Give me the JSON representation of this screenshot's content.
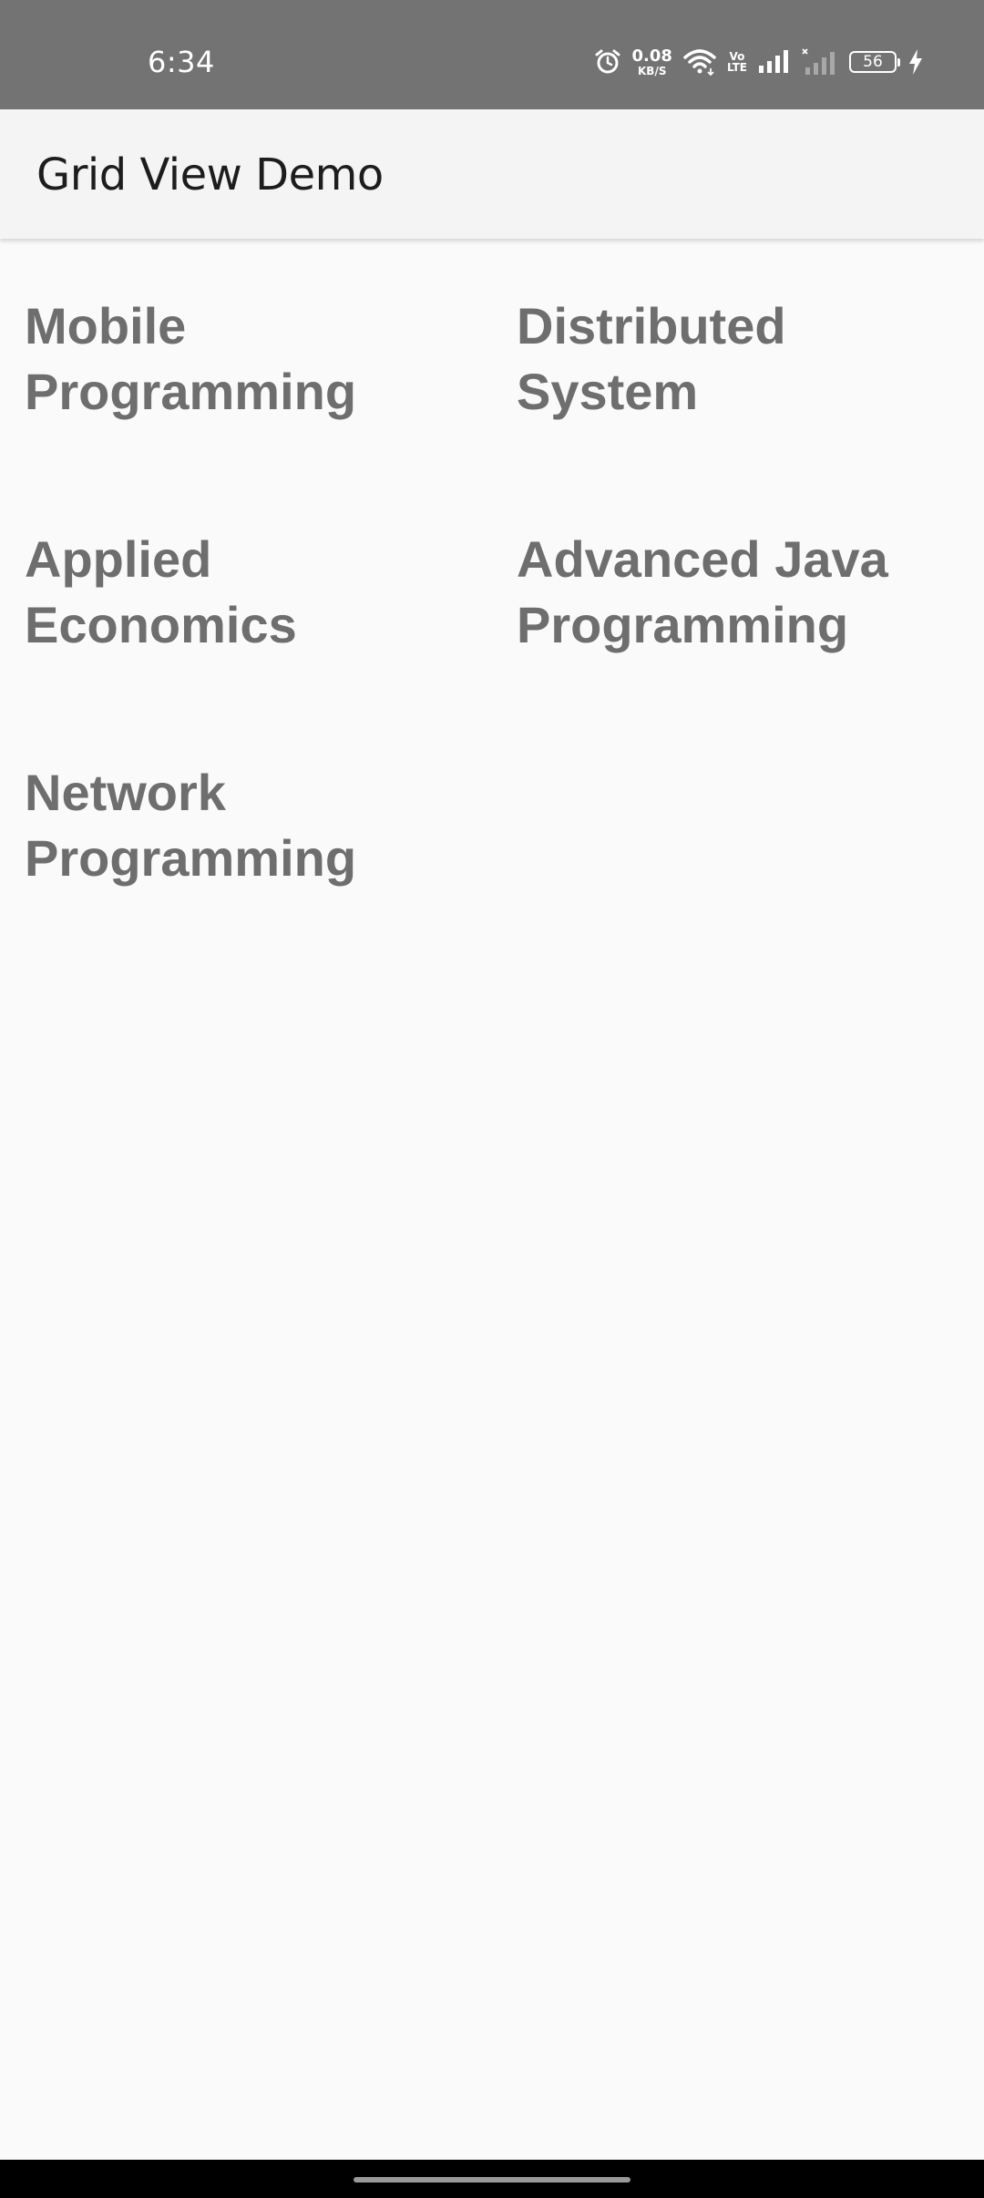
{
  "status_bar": {
    "time": "6:34",
    "net_speed_value": "0.08",
    "net_speed_unit": "KB/S",
    "volte_top": "Vo",
    "volte_bottom": "LTE",
    "battery_level": "56",
    "icons": [
      "alarm-icon",
      "wifi-icon",
      "signal-icon",
      "signal-off-icon",
      "charging-icon"
    ]
  },
  "app_bar": {
    "title": "Grid View Demo"
  },
  "grid": {
    "items": [
      "Mobile Programming",
      "Distributed System",
      "Applied Economics",
      "Advanced Java Programming",
      "Network Programming"
    ]
  },
  "colors": {
    "status_bar": "#737373",
    "app_bar": "#f4f4f4",
    "background": "#fafafa",
    "item_text": "#6e6e6e",
    "title_text": "#1d1d1d"
  }
}
